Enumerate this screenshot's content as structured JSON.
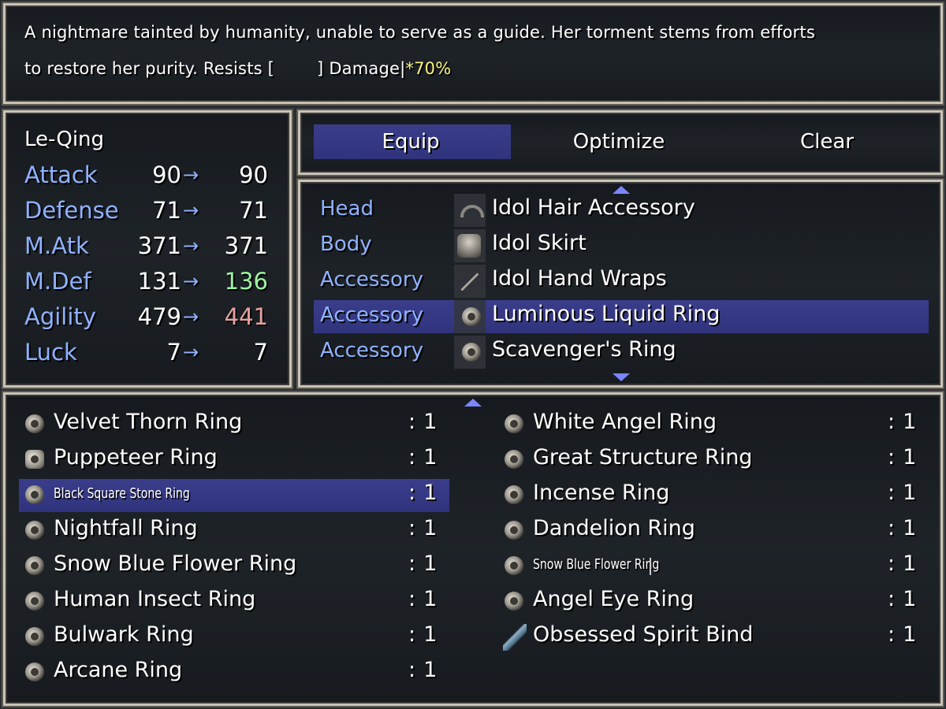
{
  "help": {
    "line1": "A nightmare tainted by humanity, unable to serve as a guide. Her torment stems from efforts",
    "line2_prefix": "to restore her purity. Resists [",
    "line2_mid": "] Damage|",
    "line2_value": "*70%"
  },
  "status": {
    "character_name": "Le-Qing",
    "arrow_glyph": "→",
    "stats": [
      {
        "label": "Attack",
        "current": "90",
        "new": "90",
        "change": "same"
      },
      {
        "label": "Defense",
        "current": "71",
        "new": "71",
        "change": "same"
      },
      {
        "label": "M.Atk",
        "current": "371",
        "new": "371",
        "change": "same"
      },
      {
        "label": "M.Def",
        "current": "131",
        "new": "136",
        "change": "up"
      },
      {
        "label": "Agility",
        "current": "479",
        "new": "441",
        "change": "down"
      },
      {
        "label": "Luck",
        "current": "7",
        "new": "7",
        "change": "same"
      }
    ]
  },
  "commands": {
    "equip": "Equip",
    "optimize": "Optimize",
    "clear": "Clear",
    "selected": "equip"
  },
  "slots": [
    {
      "type": "Head",
      "item": "Idol Hair Accessory",
      "icon": "hair-accessory-icon"
    },
    {
      "type": "Body",
      "item": "Idol Skirt",
      "icon": "armor-icon"
    },
    {
      "type": "Accessory",
      "item": "Idol Hand Wraps",
      "icon": "wraps-icon"
    },
    {
      "type": "Accessory",
      "item": "Luminous Liquid Ring",
      "icon": "ring-icon",
      "selected": true
    },
    {
      "type": "Accessory",
      "item": "Scavenger's Ring",
      "icon": "ring-icon"
    }
  ],
  "items": {
    "count_prefix": ":",
    "left": [
      {
        "name": "Velvet Thorn Ring",
        "count": "1",
        "icon": "ring-icon"
      },
      {
        "name": "Puppeteer Ring",
        "count": "1",
        "icon": "puppet-ring-icon"
      },
      {
        "name": "Black Square Stone Ring",
        "count": "1",
        "icon": "ring-icon",
        "selected": true,
        "small": true
      },
      {
        "name": "Nightfall Ring",
        "count": "1",
        "icon": "ring-icon"
      },
      {
        "name": "Snow Blue Flower Ring",
        "count": "1",
        "icon": "ring-icon"
      },
      {
        "name": "Human Insect Ring",
        "count": "1",
        "icon": "ring-icon"
      },
      {
        "name": "Bulwark Ring",
        "count": "1",
        "icon": "ring-icon"
      },
      {
        "name": "Arcane Ring",
        "count": "1",
        "icon": "ring-icon"
      }
    ],
    "right": [
      {
        "name": "White Angel Ring",
        "count": "1",
        "icon": "ring-icon"
      },
      {
        "name": "Great Structure Ring",
        "count": "1",
        "icon": "ring-icon"
      },
      {
        "name": "Incense Ring",
        "count": "1",
        "icon": "ring-icon"
      },
      {
        "name": "Dandelion Ring",
        "count": "1",
        "icon": "ring-icon"
      },
      {
        "name": "Snow Blue Flower Ring",
        "count": "1",
        "icon": "ring-icon",
        "small": true
      },
      {
        "name": "Angel Eye Ring",
        "count": "1",
        "icon": "ring-icon"
      },
      {
        "name": "Obsessed Spirit Bind",
        "count": "1",
        "icon": "spirit-bind-icon"
      }
    ]
  },
  "colors": {
    "label_blue": "#8fb2ff",
    "stat_up": "#9cf2a0",
    "stat_down": "#e8a0a0",
    "highlight": "#f6f37a",
    "selection": "#30337c"
  }
}
